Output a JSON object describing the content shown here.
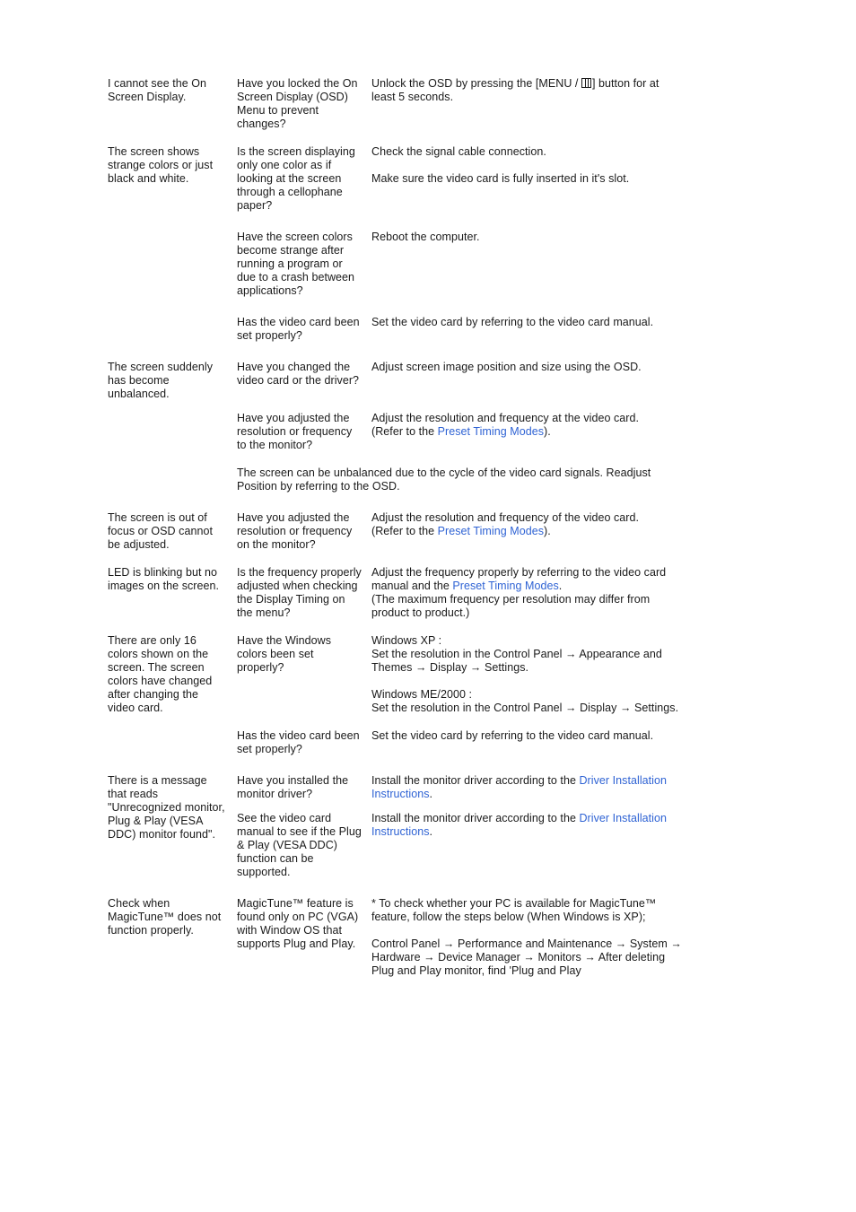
{
  "document": {
    "type": "monitor-user-manual-troubleshooting-table",
    "background_color": "#ffffff",
    "text_color": "#1a1a1a",
    "link_color": "#2f63d4"
  },
  "icons": {
    "menu_button_glyph": "menu-grid-icon"
  },
  "rows": [
    {
      "id": "osd-not-visible",
      "symptom": "I cannot see the On Screen Display.",
      "checklist": [
        "Have you locked the On Screen Display (OSD) Menu to prevent changes?"
      ],
      "solutions": [
        {
          "segments": [
            {
              "text": "Unlock the OSD by pressing the [MENU / ",
              "kind": "text"
            },
            {
              "text": "menu-glyph",
              "kind": "icon"
            },
            {
              "text": "] button for at least 5 seconds.",
              "kind": "text"
            }
          ]
        }
      ]
    },
    {
      "id": "strange-colors",
      "symptom": "The screen shows strange colors or just black and white.",
      "checklist": [
        "Is the screen displaying only one color as if looking at the screen through a cellophane paper?"
      ],
      "solutions": [
        {
          "segments": [
            {
              "text": "Check the signal cable connection.",
              "kind": "text"
            }
          ]
        },
        {
          "segments": [
            {
              "text": "Make sure the video card is fully inserted in it's slot.",
              "kind": "text"
            }
          ]
        }
      ]
    },
    {
      "id": "strange-colors-after-crash",
      "symptom": "",
      "checklist": [
        "Have the screen colors become strange after running a program or due to a crash between applications?"
      ],
      "solutions": [
        {
          "segments": [
            {
              "text": "Reboot the computer.",
              "kind": "text"
            }
          ]
        }
      ]
    },
    {
      "id": "video-card-set-1",
      "symptom": "",
      "checklist": [
        "Has the video card been set properly?"
      ],
      "solutions": [
        {
          "segments": [
            {
              "text": "Set the video card by referring to the video card manual.",
              "kind": "text"
            }
          ]
        }
      ]
    },
    {
      "id": "screen-unbalanced",
      "symptom": "The screen suddenly has become unbalanced.",
      "checklist": [
        "Have you changed the video card or the driver?"
      ],
      "solutions": [
        {
          "segments": [
            {
              "text": "Adjust screen image position and size using the OSD.",
              "kind": "text"
            }
          ]
        }
      ]
    },
    {
      "id": "screen-unbalanced-resolution",
      "symptom": "",
      "checklist": [
        "Have you adjusted the resolution or frequency to the monitor?"
      ],
      "solutions": [
        {
          "segments": [
            {
              "text": "Adjust the resolution and frequency at the video card.",
              "kind": "text"
            },
            {
              "text": "BR",
              "kind": "break"
            },
            {
              "text": "(Refer to the ",
              "kind": "text"
            },
            {
              "text": "Preset Timing Modes",
              "kind": "link"
            },
            {
              "text": ").",
              "kind": "text"
            }
          ]
        }
      ]
    },
    {
      "id": "screen-unbalanced-note",
      "symptom": "",
      "checklist": [],
      "full_width_note": "The screen can be unbalanced due to the cycle of the video card signals. Readjust Position by referring to the OSD."
    },
    {
      "id": "out-of-focus",
      "symptom": "The screen is out of focus or OSD cannot be adjusted.",
      "checklist": [
        "Have you adjusted the resolution or frequency on the monitor?"
      ],
      "solutions": [
        {
          "segments": [
            {
              "text": "Adjust the resolution and frequency of the video card.",
              "kind": "text"
            },
            {
              "text": "BR",
              "kind": "break"
            },
            {
              "text": "(Refer to the ",
              "kind": "text"
            },
            {
              "text": "Preset Timing Modes",
              "kind": "link"
            },
            {
              "text": ").",
              "kind": "text"
            }
          ]
        }
      ]
    },
    {
      "id": "led-blinking",
      "symptom": "LED is blinking but no images on the screen.",
      "checklist": [
        "Is the frequency properly adjusted when checking the Display Timing on the menu?"
      ],
      "solutions": [
        {
          "segments": [
            {
              "text": "Adjust the frequency properly by referring to the video card manual and the ",
              "kind": "text"
            },
            {
              "text": "Preset Timing Modes",
              "kind": "link"
            },
            {
              "text": ".",
              "kind": "text"
            },
            {
              "text": "BR",
              "kind": "break"
            },
            {
              "text": "(The maximum frequency per resolution may differ from product to product.)",
              "kind": "text"
            }
          ]
        }
      ]
    },
    {
      "id": "only-16-colors",
      "symptom": "There are only 16 colors shown on the screen. The screen colors have changed after changing the video card.",
      "checklist": [
        "Have the Windows colors been set properly?"
      ],
      "solutions": [
        {
          "segments": [
            {
              "text": "Windows XP :",
              "kind": "text"
            },
            {
              "text": "BR",
              "kind": "break"
            },
            {
              "text": "Set the resolution in the Control Panel → Appearance and Themes → Display → Settings.",
              "kind": "text"
            }
          ]
        },
        {
          "segments": [
            {
              "text": "Windows ME/2000 :",
              "kind": "text"
            },
            {
              "text": "BR",
              "kind": "break"
            },
            {
              "text": "Set the resolution in the Control Panel → Display → Settings.",
              "kind": "text"
            }
          ]
        }
      ]
    },
    {
      "id": "video-card-set-2",
      "symptom": "",
      "checklist": [
        "Has the video card been set properly?"
      ],
      "solutions": [
        {
          "segments": [
            {
              "text": "Set the video card by referring to the video card manual.",
              "kind": "text"
            }
          ]
        }
      ]
    },
    {
      "id": "unrecognized-monitor",
      "symptom": "There is a message that reads \"Unrecognized monitor, Plug & Play (VESA DDC) monitor found\".",
      "checklist": [
        "Have you installed the monitor driver?"
      ],
      "solutions": [
        {
          "segments": [
            {
              "text": "Install the monitor driver according to the ",
              "kind": "text"
            },
            {
              "text": "Driver Installation Instructions",
              "kind": "link"
            },
            {
              "text": ".",
              "kind": "text"
            }
          ]
        }
      ]
    },
    {
      "id": "unrecognized-monitor-vesa",
      "symptom": "",
      "checklist": [
        "See the video card manual to see if the Plug & Play (VESA DDC) function can be supported."
      ],
      "solutions": [
        {
          "segments": [
            {
              "text": "Install the monitor driver according to the ",
              "kind": "text"
            },
            {
              "text": "Driver Installation Instructions",
              "kind": "link"
            },
            {
              "text": ".",
              "kind": "text"
            }
          ]
        }
      ]
    },
    {
      "id": "magictune-not-working",
      "symptom": "Check when MagicTune™ does not function properly.",
      "checklist": [
        "MagicTune™ feature is found only on PC (VGA) with Window OS that supports Plug and Play."
      ],
      "solutions": [
        {
          "segments": [
            {
              "text": "* To check whether your PC is available for MagicTune™ feature, follow the steps below (When Windows is XP);",
              "kind": "text"
            }
          ]
        },
        {
          "segments": [
            {
              "text": "Control Panel → Performance and Maintenance → System → Hardware → Device Manager → Monitors → After deleting Plug and Play monitor, find 'Plug and Play",
              "kind": "text"
            }
          ]
        }
      ]
    }
  ]
}
